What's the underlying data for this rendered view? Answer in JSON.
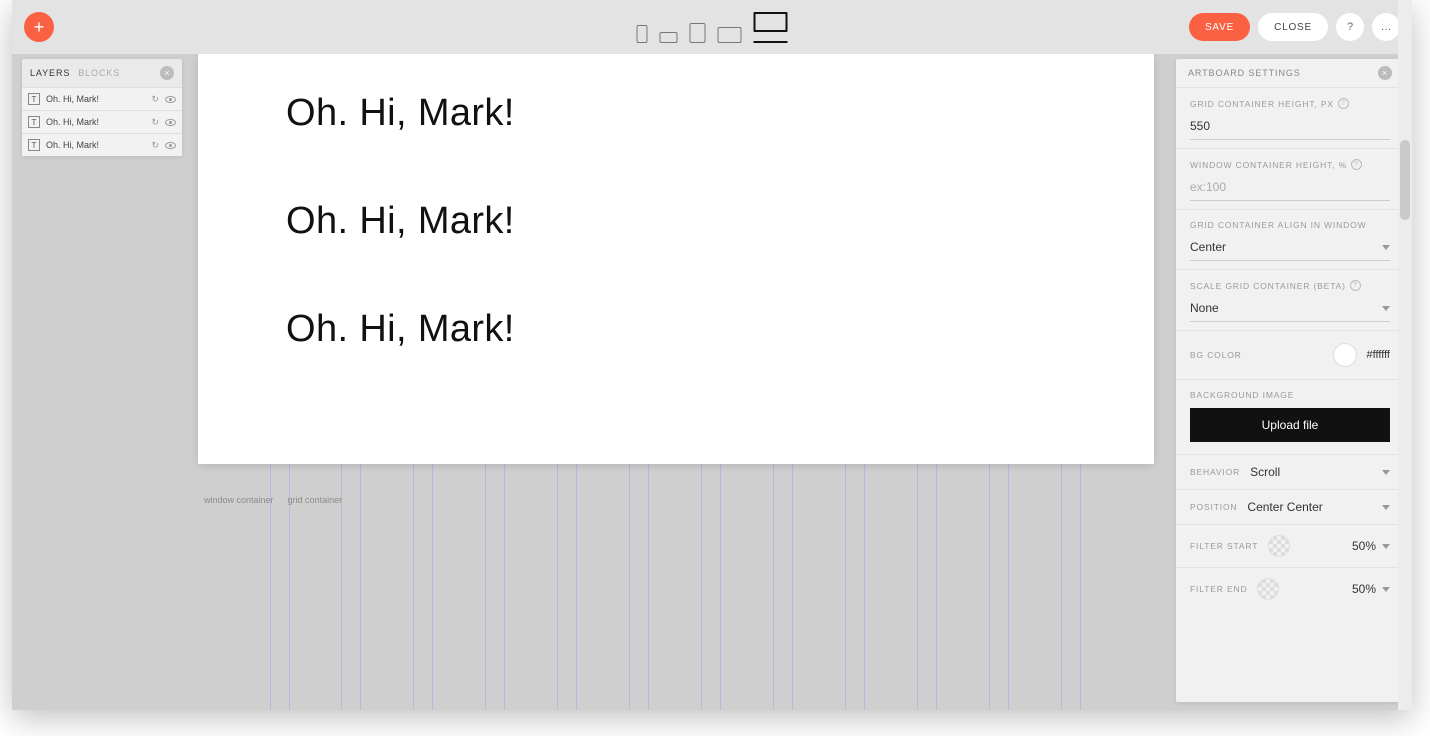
{
  "topbar": {
    "save": "SAVE",
    "close": "CLOSE",
    "help_glyph": "?",
    "more_glyph": "…",
    "active_breakpoint": "desktop"
  },
  "layers": {
    "tabs": {
      "layers": "LAYERS",
      "blocks": "BLOCKS"
    },
    "items": [
      {
        "label": "Oh. Hi, Mark!"
      },
      {
        "label": "Oh. Hi, Mark!"
      },
      {
        "label": "Oh. Hi, Mark!"
      }
    ]
  },
  "canvas": {
    "texts": [
      "Oh. Hi, Mark!",
      "Oh. Hi, Mark!",
      "Oh. Hi, Mark!"
    ],
    "container_labels": {
      "window": "window container",
      "grid": "grid container"
    }
  },
  "settings": {
    "title": "ARTBOARD SETTINGS",
    "grid_height_label": "GRID CONTAINER HEIGHT, PX",
    "grid_height_value": "550",
    "window_height_label": "WINDOW CONTAINER HEIGHT, %",
    "window_height_placeholder": "ex:100",
    "align_label": "GRID CONTAINER ALIGN IN WINDOW",
    "align_value": "Center",
    "scale_label": "SCALE GRID CONTAINER (BETA)",
    "scale_value": "None",
    "bg_color_label": "BG COLOR",
    "bg_color_value": "#ffffff",
    "bg_image_label": "BACKGROUND IMAGE",
    "upload_label": "Upload file",
    "behavior_label": "BEHAVIOR",
    "behavior_value": "Scroll",
    "position_label": "POSITION",
    "position_value": "Center Center",
    "filter_start_label": "FILTER START",
    "filter_start_value": "50%",
    "filter_end_label": "FILTER END",
    "filter_end_value": "50%"
  }
}
